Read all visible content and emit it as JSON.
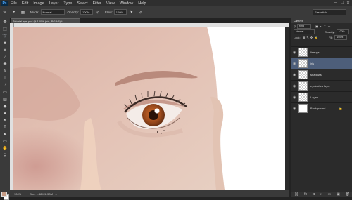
{
  "app": {
    "logo": "Ps"
  },
  "menu": [
    "File",
    "Edit",
    "Image",
    "Layer",
    "Type",
    "Select",
    "Filter",
    "View",
    "Window",
    "Help"
  ],
  "window_controls": {
    "minimize": "–",
    "maximize": "□",
    "close": "✕"
  },
  "options": {
    "mode_label": "Mode:",
    "mode_value": "Normal",
    "opacity_label": "Opacity:",
    "opacity_value": "100%",
    "flow_label": "Flow:",
    "flow_value": "100%"
  },
  "workspace": "Essentials",
  "document": {
    "tab_title": "Tutorial eye.psd @ 100% (iris, RGB/8) *",
    "zoom": "100%",
    "doc_info": "Doc: 1.48M/6.53M"
  },
  "colors": {
    "foreground": "#c59a83",
    "background": "#ffffff",
    "selected_layer": "#4d5e7a"
  },
  "layers_panel": {
    "tab": "Layers",
    "kind_label": "Kind",
    "blend_mode": "Normal",
    "opacity_label": "Opacity:",
    "opacity_value": "100%",
    "lock_label": "Lock:",
    "fill_label": "Fill:",
    "fill_value": "100%",
    "layers": [
      {
        "name": "lineups",
        "thumb": "checker",
        "selected": false
      },
      {
        "name": "iris",
        "thumb": "checker",
        "selected": true
      },
      {
        "name": "shadows",
        "thumb": "checker",
        "selected": false
      },
      {
        "name": "eyelashes layer",
        "thumb": "checker",
        "selected": false
      },
      {
        "name": "Layer",
        "thumb": "checker",
        "selected": false
      },
      {
        "name": "Background",
        "thumb": "white",
        "selected": false,
        "locked": true
      }
    ]
  }
}
